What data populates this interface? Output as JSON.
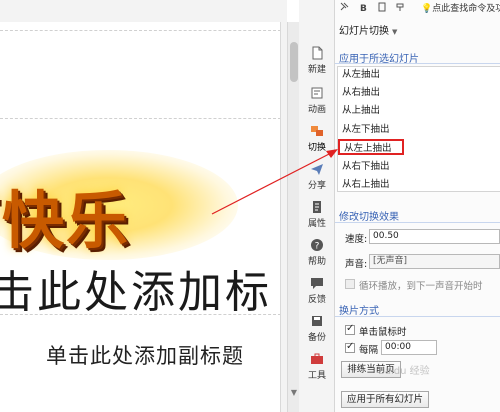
{
  "toolbar": {
    "search_text": "点此查找命令及功"
  },
  "slide": {
    "wordart_text": "节快乐",
    "title_placeholder": "击此处添加标",
    "subtitle_placeholder": "单击此处添加副标题"
  },
  "sidebar": {
    "items": [
      {
        "label": "新建",
        "icon": "new-file-icon"
      },
      {
        "label": "动画",
        "icon": "animation-icon"
      },
      {
        "label": "切换",
        "icon": "transition-icon"
      },
      {
        "label": "分享",
        "icon": "share-icon"
      },
      {
        "label": "属性",
        "icon": "properties-icon"
      },
      {
        "label": "帮助",
        "icon": "help-icon"
      },
      {
        "label": "反馈",
        "icon": "feedback-icon"
      },
      {
        "label": "备份",
        "icon": "backup-icon"
      },
      {
        "label": "工具",
        "icon": "tools-icon"
      }
    ]
  },
  "pane": {
    "title": "幻灯片切换",
    "apply_section": "应用于所选幻灯片",
    "transitions": [
      "从左抽出",
      "从右抽出",
      "从上抽出",
      "从左下抽出",
      "从左上抽出",
      "从右下抽出",
      "从右上抽出"
    ],
    "selected_transition": "从左上抽出",
    "modify_section": "修改切换效果",
    "speed_label": "速度:",
    "speed_value": "00.50",
    "sound_label": "声音:",
    "sound_value": "[无声音]",
    "loop_label": "循环播放，到下一声音开始时",
    "advance_section": "换片方式",
    "on_click_label": "单击鼠标时",
    "every_label": "每隔",
    "every_value": "00:00",
    "apply_current_button": "排练当前页",
    "apply_all_button": "应用于所有幻灯片"
  },
  "watermark": "Baidu 经验",
  "colors": {
    "section_heading": "#3a64b5",
    "highlight_border": "#e02222",
    "arrow": "#e02222"
  }
}
